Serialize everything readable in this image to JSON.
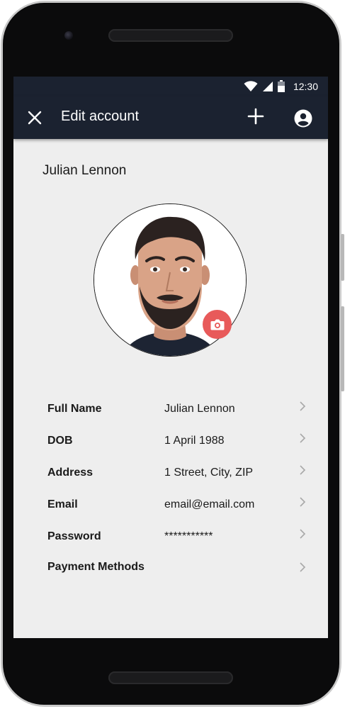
{
  "status_bar": {
    "time": "12:30",
    "icons": [
      "wifi-icon",
      "signal-icon",
      "battery-icon"
    ]
  },
  "app_bar": {
    "title": "Edit account",
    "close_icon": "close-icon",
    "add_icon": "add-icon",
    "account_icon": "account-circle-icon"
  },
  "profile": {
    "name": "Julian Lennon",
    "camera_icon": "camera-icon"
  },
  "fields": [
    {
      "label": "Full Name",
      "value": "Julian Lennon"
    },
    {
      "label": "DOB",
      "value": "1 April 1988"
    },
    {
      "label": "Address",
      "value": "1 Street, City, ZIP"
    },
    {
      "label": "Email",
      "value": "email@email.com"
    },
    {
      "label": "Password",
      "value": "***********"
    },
    {
      "label": "Payment Methods",
      "value": ""
    }
  ],
  "colors": {
    "app_bar": "#1b2230",
    "screen_bg": "#eeeeee",
    "accent": "#e85a5a"
  }
}
